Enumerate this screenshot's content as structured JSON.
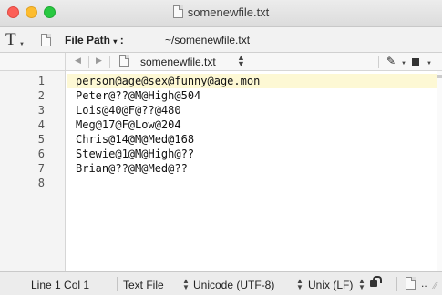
{
  "window": {
    "title": "somenewfile.txt"
  },
  "pathbar": {
    "tool_icon": "T",
    "path_label": "File Path",
    "path_caret": "▾",
    "path_separator": ":",
    "path_value": "~/somenewfile.txt"
  },
  "navbar": {
    "prev_icon": "◀",
    "next_icon": "▶",
    "file_name": "somenewfile.txt",
    "stepper": "▲▼",
    "pen_icon": "✎"
  },
  "editor": {
    "line_numbers": [
      "1",
      "2",
      "3",
      "4",
      "5",
      "6",
      "7",
      "8"
    ],
    "lines": [
      "person@age@sex@funny@age.mon",
      "Peter@??@M@High@504",
      "Lois@40@F@??@480",
      "Meg@17@F@Low@204",
      "Chris@14@M@Med@168",
      "Stewie@1@M@High@??",
      "Brian@??@M@Med@??",
      ""
    ],
    "highlight_color": "#fdf8d4"
  },
  "statusbar": {
    "position": "Line 1 Col 1",
    "syntax": "Text File",
    "encoding": "Unicode (UTF-8)",
    "line_endings": "Unix (LF)",
    "dots": "..",
    "grip": "⁄⁄"
  },
  "colors": {
    "close": "#fc5f57",
    "minimize": "#fdbc2e",
    "zoom": "#28c840"
  }
}
